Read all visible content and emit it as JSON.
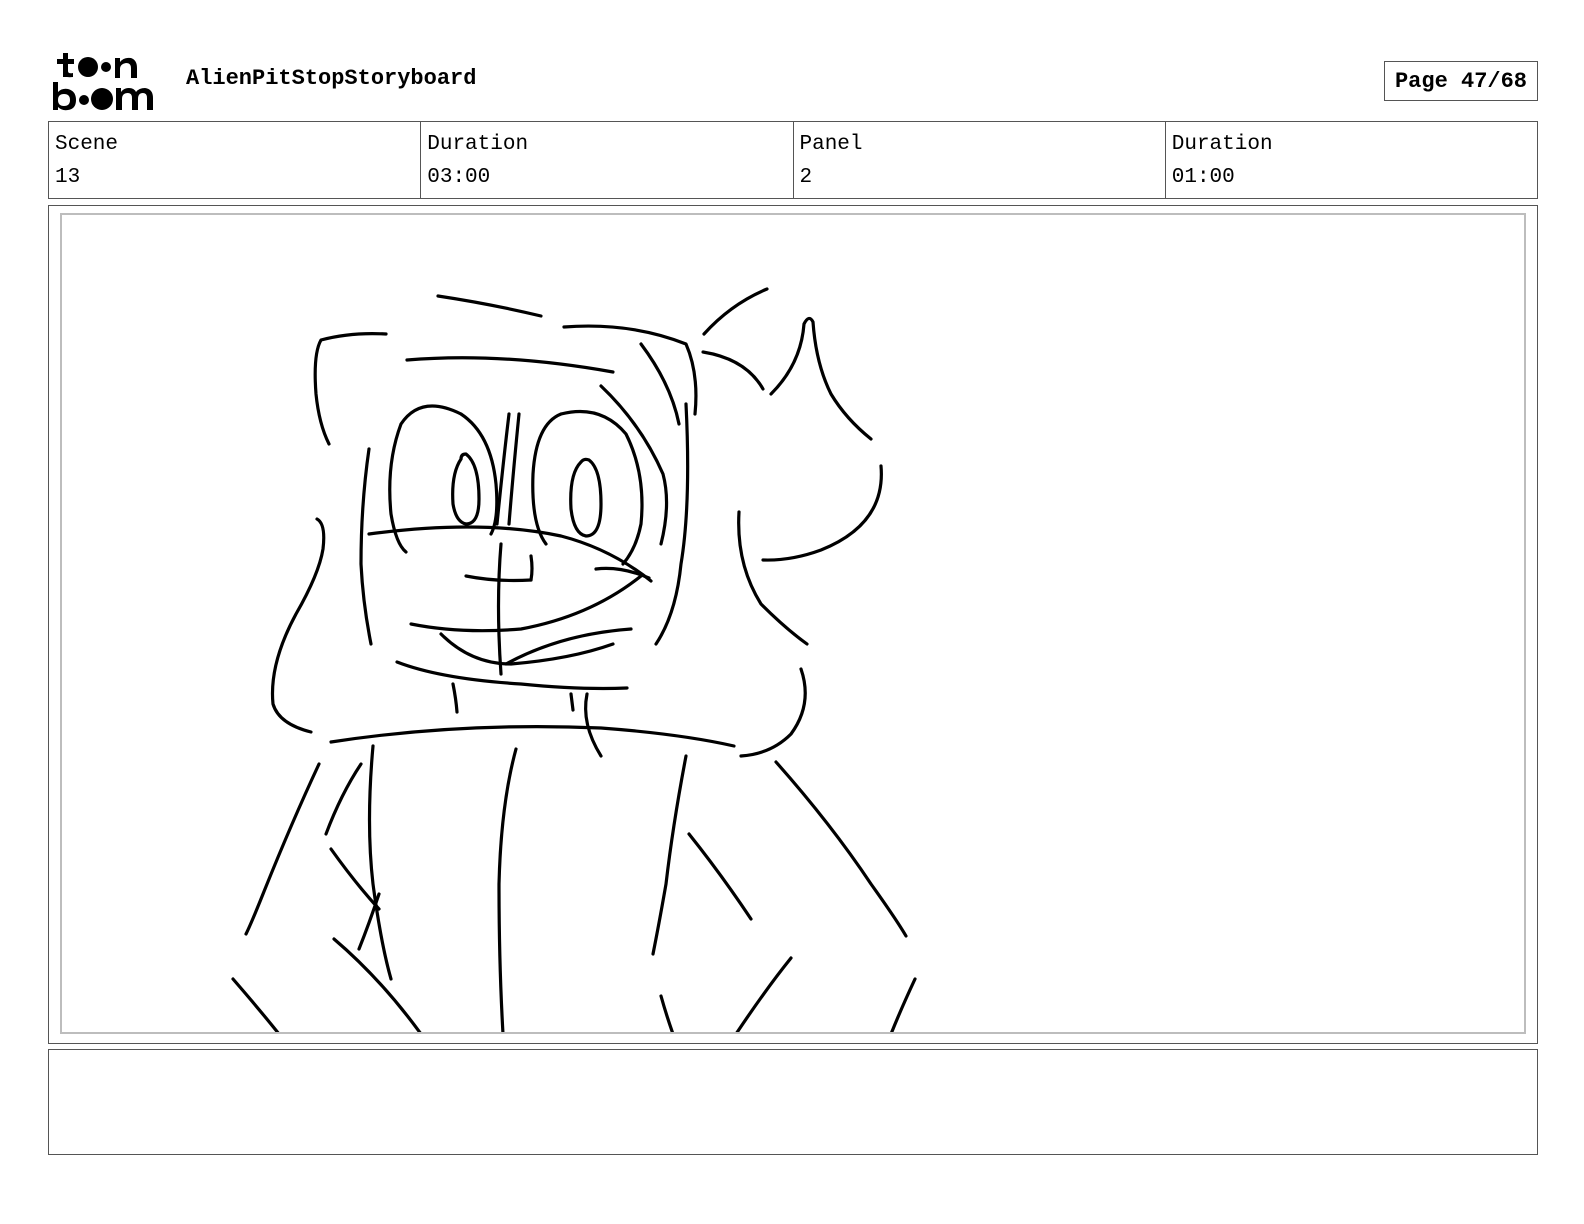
{
  "header": {
    "logo_text": "toon boom",
    "project_title": "AlienPitStopStoryboard",
    "page_label": "Page 47/68"
  },
  "info": {
    "scene_label": "Scene",
    "scene_value": "13",
    "scene_duration_label": "Duration",
    "scene_duration_value": "03:00",
    "panel_label": "Panel",
    "panel_value": "2",
    "panel_duration_label": "Duration",
    "panel_duration_value": "01:00"
  },
  "panel": {
    "sketch": "rough-pencil-character-sketch"
  },
  "notes": {
    "text": ""
  }
}
